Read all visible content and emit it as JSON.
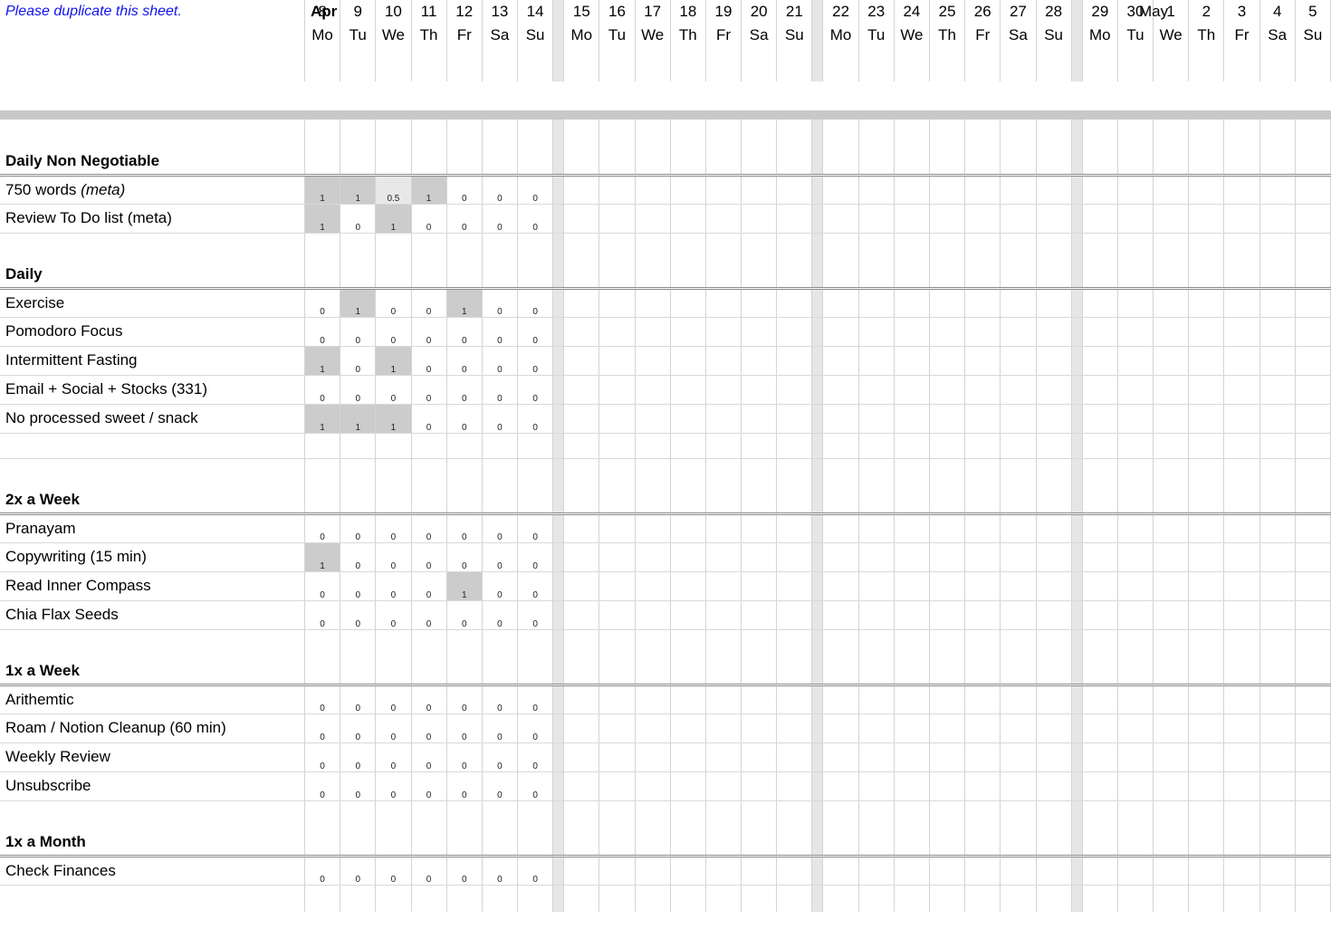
{
  "sheet": {
    "note": "Please duplicate this sheet.",
    "months": [
      {
        "label": "Apr",
        "col_index": 0
      },
      {
        "label": "May",
        "col_index": 23
      }
    ]
  },
  "columns": {
    "label_header": "",
    "days": [
      {
        "num": "8",
        "dow": "Mo"
      },
      {
        "num": "9",
        "dow": "Tu"
      },
      {
        "num": "10",
        "dow": "We"
      },
      {
        "num": "11",
        "dow": "Th"
      },
      {
        "num": "12",
        "dow": "Fr"
      },
      {
        "num": "13",
        "dow": "Sa"
      },
      {
        "num": "14",
        "dow": "Su"
      },
      {
        "num": "15",
        "dow": "Mo"
      },
      {
        "num": "16",
        "dow": "Tu"
      },
      {
        "num": "17",
        "dow": "We"
      },
      {
        "num": "18",
        "dow": "Th"
      },
      {
        "num": "19",
        "dow": "Fr"
      },
      {
        "num": "20",
        "dow": "Sa"
      },
      {
        "num": "21",
        "dow": "Su"
      },
      {
        "num": "22",
        "dow": "Mo"
      },
      {
        "num": "23",
        "dow": "Tu"
      },
      {
        "num": "24",
        "dow": "We"
      },
      {
        "num": "25",
        "dow": "Th"
      },
      {
        "num": "26",
        "dow": "Fr"
      },
      {
        "num": "27",
        "dow": "Sa"
      },
      {
        "num": "28",
        "dow": "Su"
      },
      {
        "num": "29",
        "dow": "Mo"
      },
      {
        "num": "30",
        "dow": "Tu"
      },
      {
        "num": "1",
        "dow": "We"
      },
      {
        "num": "2",
        "dow": "Th"
      },
      {
        "num": "3",
        "dow": "Fr"
      },
      {
        "num": "4",
        "dow": "Sa"
      },
      {
        "num": "5",
        "dow": "Su"
      }
    ],
    "week_separator_after": [
      6,
      13,
      20
    ]
  },
  "rows": [
    {
      "type": "section",
      "label": "Daily Non Negotiable"
    },
    {
      "type": "habit",
      "label": "750 words ",
      "label_italic": "(meta)",
      "values": [
        "1",
        "1",
        "0.5",
        "1",
        "0",
        "0",
        "0"
      ]
    },
    {
      "type": "habit",
      "label": "Review To Do list (meta)",
      "values": [
        "1",
        "0",
        "1",
        "0",
        "0",
        "0",
        "0"
      ]
    },
    {
      "type": "section",
      "label": "Daily"
    },
    {
      "type": "habit",
      "label": "Exercise",
      "values": [
        "0",
        "1",
        "0",
        "0",
        "1",
        "0",
        "0"
      ]
    },
    {
      "type": "habit",
      "label": "Pomodoro Focus",
      "values": [
        "0",
        "0",
        "0",
        "0",
        "0",
        "0",
        "0"
      ]
    },
    {
      "type": "habit",
      "label": "Intermittent Fasting",
      "values": [
        "1",
        "0",
        "1",
        "0",
        "0",
        "0",
        "0"
      ]
    },
    {
      "type": "habit",
      "label": "Email + Social + Stocks (331)",
      "values": [
        "0",
        "0",
        "0",
        "0",
        "0",
        "0",
        "0"
      ]
    },
    {
      "type": "habit",
      "label": "No processed sweet / snack",
      "values": [
        "1",
        "1",
        "1",
        "0",
        "0",
        "0",
        "0"
      ]
    },
    {
      "type": "blank",
      "label": ""
    },
    {
      "type": "section",
      "label": "2x a Week"
    },
    {
      "type": "habit",
      "label": "Pranayam",
      "values": [
        "0",
        "0",
        "0",
        "0",
        "0",
        "0",
        "0"
      ]
    },
    {
      "type": "habit",
      "label": "Copywriting (15 min)",
      "values": [
        "1",
        "0",
        "0",
        "0",
        "0",
        "0",
        "0"
      ]
    },
    {
      "type": "habit",
      "label": "Read Inner Compass",
      "values": [
        "0",
        "0",
        "0",
        "0",
        "1",
        "0",
        "0"
      ]
    },
    {
      "type": "habit",
      "label": "Chia Flax Seeds",
      "values": [
        "0",
        "0",
        "0",
        "0",
        "0",
        "0",
        "0"
      ]
    },
    {
      "type": "section",
      "label": "1x a Week"
    },
    {
      "type": "habit",
      "label": "Arithemtic",
      "values": [
        "0",
        "0",
        "0",
        "0",
        "0",
        "0",
        "0"
      ]
    },
    {
      "type": "habit",
      "label": "Roam / Notion Cleanup (60 min)",
      "values": [
        "0",
        "0",
        "0",
        "0",
        "0",
        "0",
        "0"
      ]
    },
    {
      "type": "habit",
      "label": "Weekly Review",
      "values": [
        "0",
        "0",
        "0",
        "0",
        "0",
        "0",
        "0"
      ]
    },
    {
      "type": "habit",
      "label": "Unsubscribe",
      "values": [
        "0",
        "0",
        "0",
        "0",
        "0",
        "0",
        "0"
      ]
    },
    {
      "type": "section",
      "label": "1x a Month"
    },
    {
      "type": "habit",
      "label": "Check Finances",
      "values": [
        "0",
        "0",
        "0",
        "0",
        "0",
        "0",
        "0"
      ]
    },
    {
      "type": "tail",
      "label": ""
    }
  ],
  "colors": {
    "note_text": "#1014ee",
    "cell_filled": "#cccccc",
    "cell_half": "#e8e8e8",
    "separator": "#e6e6e6",
    "freeze_band": "#c8c8c8",
    "grid_line": "#d4d4d4"
  }
}
